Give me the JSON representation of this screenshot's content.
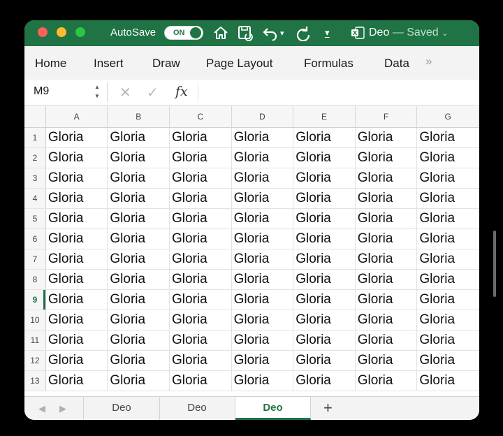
{
  "titlebar": {
    "autosave_label": "AutoSave",
    "autosave_state": "ON",
    "document_name": "Deo",
    "save_status": "— Saved",
    "icons": [
      "home-icon",
      "save-icon",
      "undo-icon",
      "undo-dropdown-icon",
      "redo-icon",
      "customize-toolbar-icon",
      "excel-file-icon",
      "chevron-down-icon"
    ]
  },
  "ribbon": {
    "tabs": [
      "Home",
      "Insert",
      "Draw",
      "Page Layout",
      "Formulas",
      "Data"
    ],
    "more_icon": "»"
  },
  "formula_bar": {
    "name_box": "M9",
    "fx_label": "fx",
    "formula": ""
  },
  "grid": {
    "columns": [
      "A",
      "B",
      "C",
      "D",
      "E",
      "F",
      "G"
    ],
    "rows": [
      "1",
      "2",
      "3",
      "4",
      "5",
      "6",
      "7",
      "8",
      "9",
      "10",
      "11",
      "12",
      "13"
    ],
    "active_row": "9",
    "cells": [
      [
        "Gloria",
        "Gloria",
        "Gloria",
        "Gloria",
        "Gloria",
        "Gloria",
        "Gloria"
      ],
      [
        "Gloria",
        "Gloria",
        "Gloria",
        "Gloria",
        "Gloria",
        "Gloria",
        "Gloria"
      ],
      [
        "Gloria",
        "Gloria",
        "Gloria",
        "Gloria",
        "Gloria",
        "Gloria",
        "Gloria"
      ],
      [
        "Gloria",
        "Gloria",
        "Gloria",
        "Gloria",
        "Gloria",
        "Gloria",
        "Gloria"
      ],
      [
        "Gloria",
        "Gloria",
        "Gloria",
        "Gloria",
        "Gloria",
        "Gloria",
        "Gloria"
      ],
      [
        "Gloria",
        "Gloria",
        "Gloria",
        "Gloria",
        "Gloria",
        "Gloria",
        "Gloria"
      ],
      [
        "Gloria",
        "Gloria",
        "Gloria",
        "Gloria",
        "Gloria",
        "Gloria",
        "Gloria"
      ],
      [
        "Gloria",
        "Gloria",
        "Gloria",
        "Gloria",
        "Gloria",
        "Gloria",
        "Gloria"
      ],
      [
        "Gloria",
        "Gloria",
        "Gloria",
        "Gloria",
        "Gloria",
        "Gloria",
        "Gloria"
      ],
      [
        "Gloria",
        "Gloria",
        "Gloria",
        "Gloria",
        "Gloria",
        "Gloria",
        "Gloria"
      ],
      [
        "Gloria",
        "Gloria",
        "Gloria",
        "Gloria",
        "Gloria",
        "Gloria",
        "Gloria"
      ],
      [
        "Gloria",
        "Gloria",
        "Gloria",
        "Gloria",
        "Gloria",
        "Gloria",
        "Gloria"
      ],
      [
        "Gloria",
        "Gloria",
        "Gloria",
        "Gloria",
        "Gloria",
        "Gloria",
        "Gloria"
      ]
    ]
  },
  "sheet_tabs": {
    "tabs": [
      "Deo",
      "Deo",
      "Deo"
    ],
    "active_index": 2,
    "add_label": "+"
  },
  "colors": {
    "accent": "#1f7345",
    "ribbon_bg": "#f3f3f3",
    "header_bg": "#f6f6f6"
  }
}
